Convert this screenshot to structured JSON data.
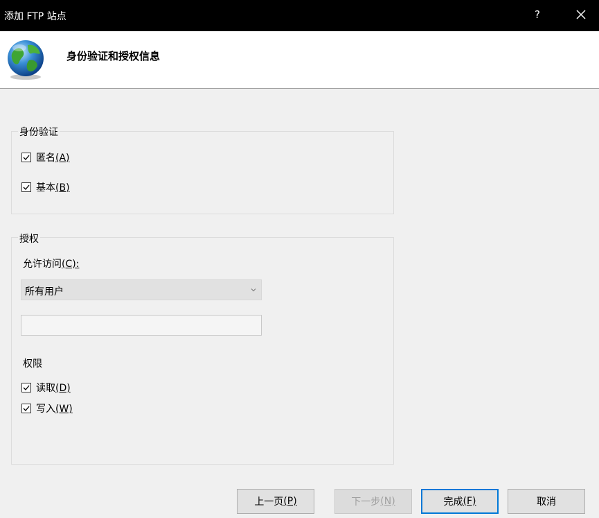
{
  "window": {
    "title": "添加 FTP 站点",
    "help_label": "?"
  },
  "header": {
    "icon": "globe-icon",
    "heading": "身份验证和授权信息"
  },
  "authentication": {
    "legend": "身份验证",
    "anonymous": {
      "label": "匿名",
      "key": "(A)",
      "checked": true
    },
    "basic": {
      "label": "基本",
      "key": "(B)",
      "checked": true
    }
  },
  "authorization": {
    "legend": "授权",
    "allow_access_label": "允许访问",
    "allow_access_key": "(C):",
    "allow_access_value": "所有用户",
    "text_value": "",
    "permissions_label": "权限",
    "read": {
      "label": "读取",
      "key": "(D)",
      "checked": true
    },
    "write": {
      "label": "写入",
      "key": "(W)",
      "checked": true
    }
  },
  "buttons": {
    "prev": {
      "label": "上一页",
      "key": "(P)"
    },
    "next": {
      "label": "下一步",
      "key": "(N)",
      "disabled": true
    },
    "finish": {
      "label": "完成",
      "key": "(F)"
    },
    "cancel": {
      "label": "取消"
    }
  }
}
